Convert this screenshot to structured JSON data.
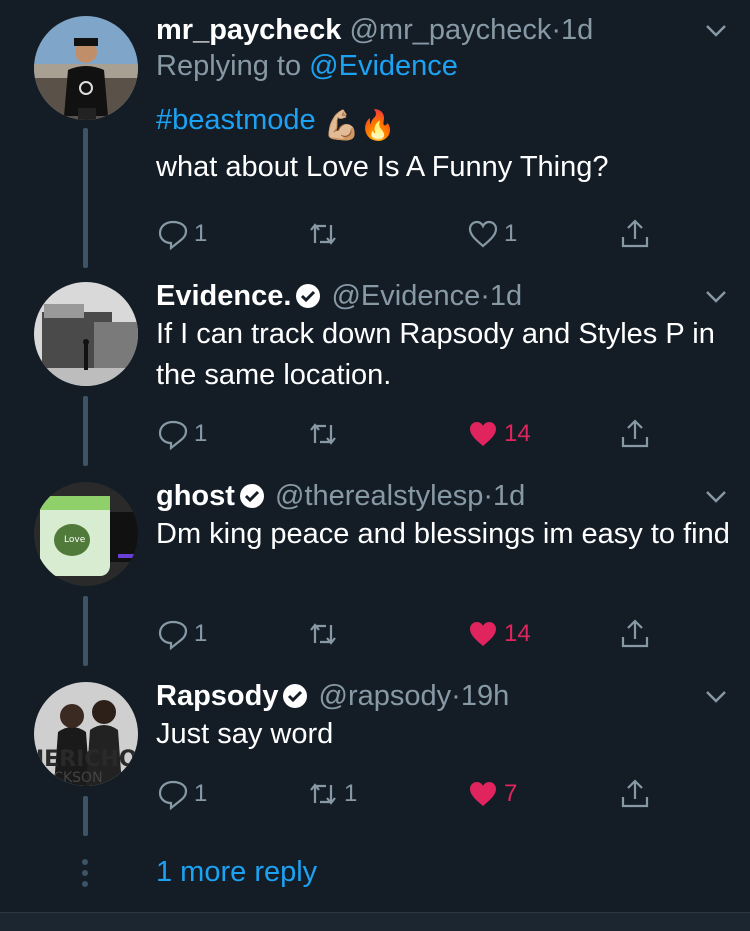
{
  "colors": {
    "background": "#141d26",
    "link": "#1da1f2",
    "muted": "#8899a6",
    "like": "#e0245e",
    "thread": "#3d5466"
  },
  "tweets": [
    {
      "name": "mr_paycheck",
      "handle": "@mr_paycheck",
      "sep": "·",
      "time": "1d",
      "replying_label": "Replying to",
      "replying_to": "@Evidence",
      "hashtag": "#beastmode",
      "emojis": "💪🏼🔥",
      "text": "what about Love Is A Funny Thing?",
      "replies": "1",
      "retweets": "",
      "likes": "1",
      "liked": false,
      "verified": false,
      "avatar": "person in black tshirt outdoors"
    },
    {
      "name": "Evidence.",
      "handle": "@Evidence",
      "sep": "·",
      "time": "1d",
      "text": "If I can track down Rapsody and Styles P in the same location.",
      "replies": "1",
      "retweets": "",
      "likes": "14",
      "liked": true,
      "verified": true,
      "avatar": "black and white street building"
    },
    {
      "name": "ghost",
      "handle": "@therealstylesp",
      "sep": "·",
      "time": "1d",
      "text": "Dm king peace and blessings im easy to find",
      "replies": "1",
      "retweets": "",
      "likes": "14",
      "liked": true,
      "verified": true,
      "avatar": "product jar"
    },
    {
      "name": "Rapsody",
      "handle": "@rapsody",
      "sep": "·",
      "time": "19h",
      "text": "Just say word",
      "replies": "1",
      "retweets": "1",
      "likes": "7",
      "liked": true,
      "verified": true,
      "avatar": "jericho jackson album art"
    }
  ],
  "more_replies": "1 more reply"
}
